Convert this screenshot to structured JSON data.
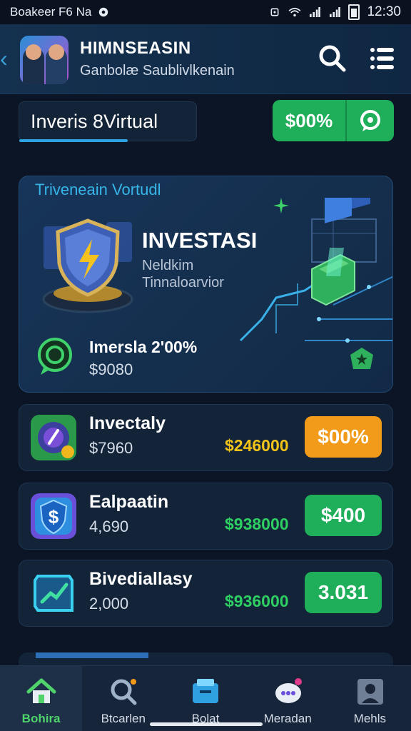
{
  "status_bar": {
    "left_text": "Boakeer F6 Na",
    "time": "12:30"
  },
  "header": {
    "title": "HIMNSEASIN",
    "subtitle": "Ganbolæ Saublivlkenain"
  },
  "tab": {
    "label": "Inveris 8Virtual"
  },
  "filter_pill": {
    "label": "$00%"
  },
  "hero": {
    "kicker": "Triveneain Vortudl",
    "title": "INVESTASI",
    "sub1": "Neldkim",
    "sub2": "Tinnaloarvior",
    "stat_label": "Imersla 2'00%",
    "stat_value": "$9080"
  },
  "rows": [
    {
      "name": "Invectaly",
      "sub": "$7960",
      "amount": "$246000",
      "cta": "$00%",
      "amount_color": "#f2c318",
      "cta_color": "#f29a1a"
    },
    {
      "name": "Ealpaatin",
      "sub": "4,690",
      "amount": "$938000",
      "cta": "$400",
      "amount_color": "#2ecf63",
      "cta_color": "#1fae5a"
    },
    {
      "name": "Bivediallasy",
      "sub": "2,000",
      "amount": "$936000",
      "cta": "3.031",
      "amount_color": "#2ecf63",
      "cta_color": "#1fae5a"
    }
  ],
  "nav": [
    {
      "label": "Bohira",
      "icon": "home-icon"
    },
    {
      "label": "Btcarlen",
      "icon": "search-icon"
    },
    {
      "label": "Bolat",
      "icon": "wallet-icon"
    },
    {
      "label": "Meradan",
      "icon": "chat-icon"
    },
    {
      "label": "Mehls",
      "icon": "profile-icon"
    }
  ]
}
